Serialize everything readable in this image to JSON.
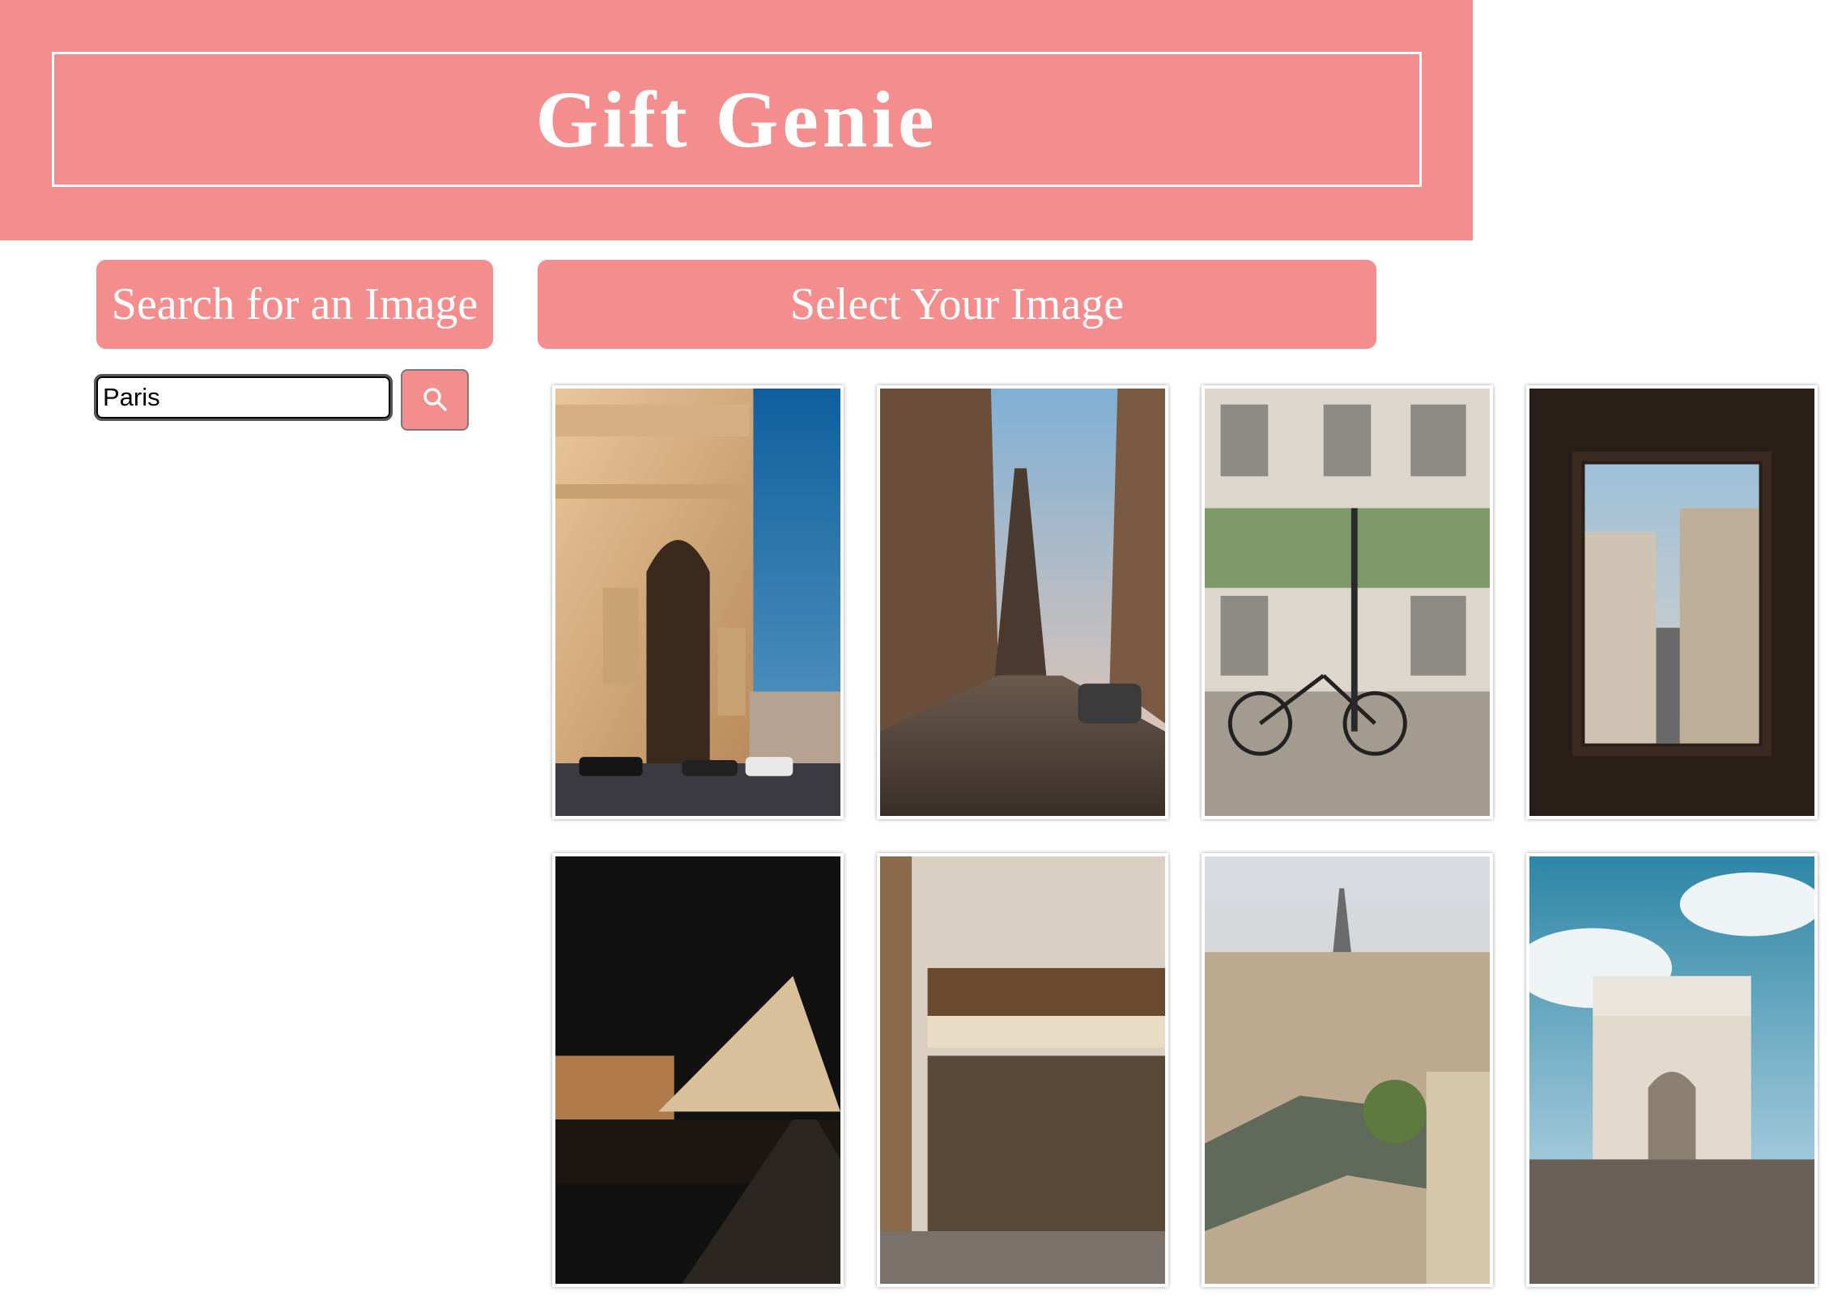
{
  "app": {
    "title": "Gift Genie"
  },
  "search": {
    "label": "Search for an Image",
    "value": "Paris",
    "button_icon": "search-icon"
  },
  "gallery": {
    "label": "Select Your Image",
    "images": [
      {
        "subject": "arc-de-triomphe-sunset"
      },
      {
        "subject": "eiffel-tower-cobblestone-street"
      },
      {
        "subject": "parisian-facade-with-bicycle"
      },
      {
        "subject": "window-view-of-paris-street"
      },
      {
        "subject": "louvre-pyramid-at-night"
      },
      {
        "subject": "parisian-cafe-storefront"
      },
      {
        "subject": "paris-skyline-over-seine"
      },
      {
        "subject": "arc-de-triomphe-blue-sky"
      }
    ]
  },
  "colors": {
    "accent": "#f38d8e",
    "text_on_accent": "#ffffff"
  }
}
